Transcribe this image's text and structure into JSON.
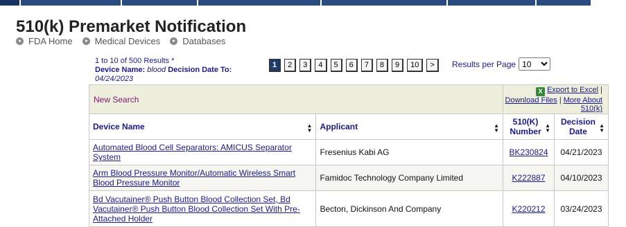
{
  "page": {
    "title": "510(k) Premarket Notification",
    "breadcrumbs": [
      "FDA Home",
      "Medical Devices",
      "Databases"
    ]
  },
  "summary": {
    "results_text": "1 to 10 of 500 Results *",
    "device_label": "Device Name:",
    "device_value": "blood",
    "date_label": "Decision Date To:",
    "date_value": "04/24/2023"
  },
  "pager": {
    "pages": [
      "1",
      "2",
      "3",
      "4",
      "5",
      "6",
      "7",
      "8",
      "9",
      "10"
    ],
    "current": "1",
    "next_label": ">"
  },
  "results_per_page": {
    "label": "Results per Page",
    "selected": "10"
  },
  "toolbar": {
    "new_search": "New Search",
    "export_excel": "Export to Excel",
    "separator": "|",
    "download_files": "Download Files",
    "more_about": "More About 510(k)",
    "excel_icon": "excel-icon"
  },
  "table": {
    "headers": [
      "Device Name",
      "Applicant",
      "510(K) Number",
      "Decision Date"
    ],
    "rows": [
      {
        "device": "Automated Blood Cell Separators: AMICUS Separator System",
        "applicant": "Fresenius Kabi AG",
        "number": "BK230824",
        "date": "04/21/2023"
      },
      {
        "device": "Arm Blood Pressure Monitor/Automatic Wireless Smart Blood Pressure Monitor",
        "applicant": "Famidoc Technology Company Limited",
        "number": "K222887",
        "date": "04/10/2023"
      },
      {
        "device": "Bd Vacutainer® Push Button Blood Collection Set, Bd Vacutainer® Push Button Blood Collection Set With Pre-Attached Holder",
        "applicant": "Becton, Dickinson And Company",
        "number": "K220212",
        "date": "03/24/2023"
      }
    ]
  },
  "colors": {
    "nav": "#2a4a7f",
    "link": "#1a1a8c",
    "toolbar_bg": "#eeeedd"
  }
}
